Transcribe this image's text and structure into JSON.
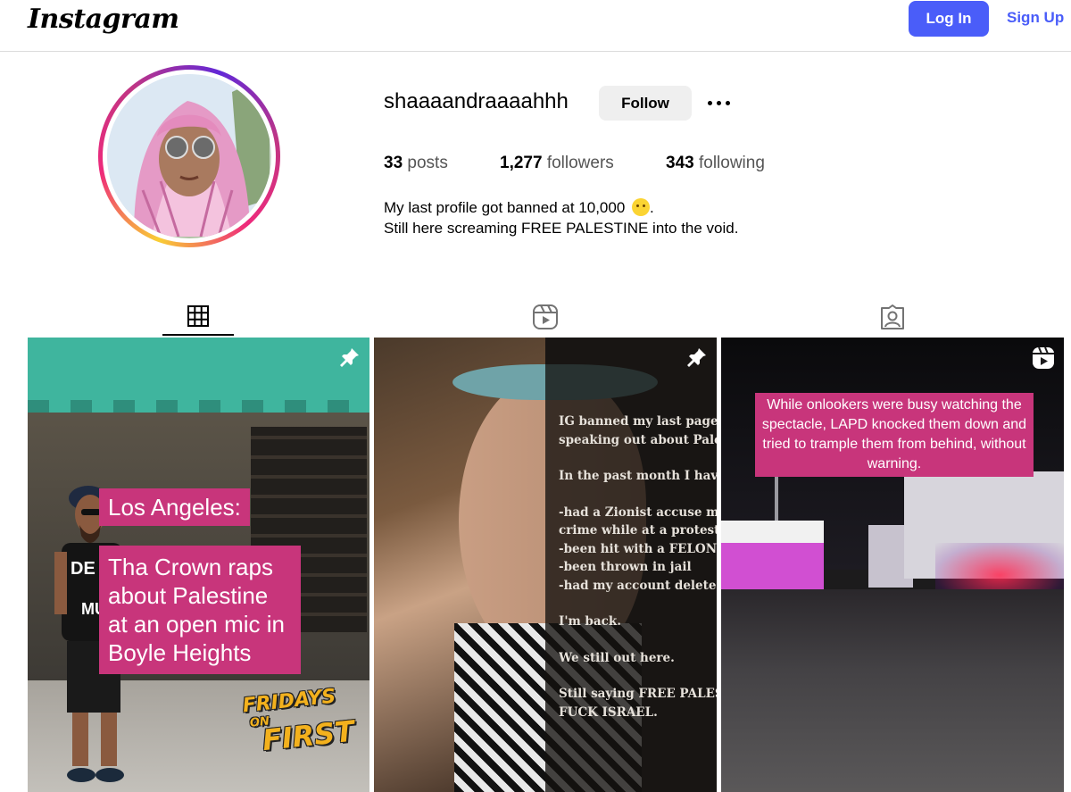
{
  "header": {
    "logo": "Instagram",
    "login_label": "Log In",
    "signup_label": "Sign Up"
  },
  "profile": {
    "username": "shaaaandraaaahhh",
    "follow_label": "Follow",
    "more_icon": "more-options-icon",
    "stats": {
      "posts_count": "33",
      "posts_label": "posts",
      "followers_count": "1,277",
      "followers_label": "followers",
      "following_count": "343",
      "following_label": "following"
    },
    "bio": {
      "line1": "My last profile got banned at 10,000",
      "line1_suffix": ".",
      "line1_emoji": "face-emoji",
      "line2": "Still here screaming FREE PALESTINE into the void."
    }
  },
  "tabs": [
    {
      "icon": "grid-icon",
      "active": true
    },
    {
      "icon": "reels-icon",
      "active": false
    },
    {
      "icon": "tagged-icon",
      "active": false
    }
  ],
  "posts": [
    {
      "badge_icon": "pin-icon",
      "caption_title": "Los Angeles:",
      "caption_body": "Tha Crown raps about Palestine at an open mic in Boyle Heights",
      "stamp_line1": "FRIDAYS",
      "stamp_line2": "ON",
      "stamp_line3": "FIRST"
    },
    {
      "badge_icon": "pin-icon",
      "lines": [
        "IG banned my last page, for",
        "speaking out about Palesti",
        "",
        "In the past month I have:",
        "",
        "-had a Zionist accuse me o",
        "crime while at a protest",
        "-been hit with a FELONY",
        "-been thrown in jail",
        "-had my account deleted",
        "",
        "I'm back.",
        "",
        "We still out here.",
        "",
        "Still saying FREE PALESTI",
        "FUCK ISRAEL."
      ]
    },
    {
      "badge_icon": "reel-badge-icon",
      "caption": "While onlookers were busy watching the spectacle, LAPD knocked them down and tried to trample them from behind, without warning."
    }
  ],
  "colors": {
    "accent": "#4a5df9",
    "caption_pink": "#c8357b"
  }
}
